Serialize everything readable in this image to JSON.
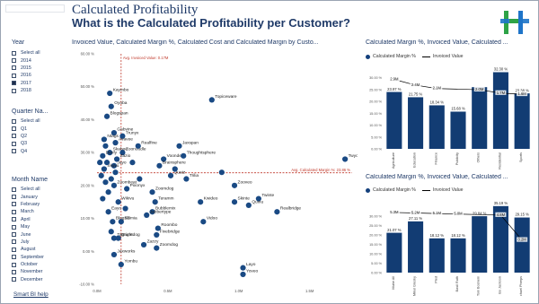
{
  "header": {
    "title": "Calculated Profitability",
    "subtitle": "What is the Calculated Profitability per Customer?"
  },
  "colors": {
    "bar": "#123c73",
    "dot": "#1a4a84",
    "ref_line": "#c0392b",
    "accent_green": "#2ea347",
    "accent_blue": "#1e74c8"
  },
  "slicers": {
    "year": {
      "title": "Year",
      "items": [
        {
          "label": "Select all",
          "checked": false
        },
        {
          "label": "2014",
          "checked": false
        },
        {
          "label": "2015",
          "checked": false
        },
        {
          "label": "2016",
          "checked": false
        },
        {
          "label": "2017",
          "checked": true
        },
        {
          "label": "2018",
          "checked": false
        }
      ]
    },
    "quarter": {
      "title": "Quarter Na...",
      "items": [
        {
          "label": "Select all",
          "checked": false
        },
        {
          "label": "Q1",
          "checked": false
        },
        {
          "label": "Q2",
          "checked": false
        },
        {
          "label": "Q3",
          "checked": false
        },
        {
          "label": "Q4",
          "checked": false
        }
      ]
    },
    "month": {
      "title": "Month Name",
      "items": [
        {
          "label": "Select all",
          "checked": false
        },
        {
          "label": "January",
          "checked": false
        },
        {
          "label": "February",
          "checked": false
        },
        {
          "label": "March",
          "checked": false
        },
        {
          "label": "April",
          "checked": false
        },
        {
          "label": "May",
          "checked": false
        },
        {
          "label": "June",
          "checked": false
        },
        {
          "label": "July",
          "checked": false
        },
        {
          "label": "August",
          "checked": false
        },
        {
          "label": "September",
          "checked": false
        },
        {
          "label": "October",
          "checked": false
        },
        {
          "label": "November",
          "checked": false
        },
        {
          "label": "December",
          "checked": false
        }
      ]
    },
    "help_label": "Smart BI help"
  },
  "chart_data": [
    {
      "type": "scatter",
      "title": "Invoiced Value, Calculated Margin %, Calculated Cost and Calculated Margin by Custo...",
      "x_ticks": [
        "0.0M",
        "0.5M",
        "1.0M",
        "1.5M"
      ],
      "y_ticks": [
        "60.00 %",
        "50.00 %",
        "40.00 %",
        "30.00 %",
        "20.00 %",
        "10.00 %",
        "0.00 %",
        "-10.00 %"
      ],
      "xlim": [
        0,
        1.8
      ],
      "ylim": [
        -10,
        60
      ],
      "ref_x": {
        "value": 0.17,
        "label": "Avg. Invoiced Value: 0.17M"
      },
      "ref_y": {
        "value": 23.86,
        "label": "Avg. Calculated Margin %: 23.86 %"
      },
      "points": [
        {
          "label": "Kaymbo",
          "x": 0.09,
          "y": 48
        },
        {
          "label": "Blogspan",
          "x": 0.07,
          "y": 41
        },
        {
          "label": "Oyoba",
          "x": 0.1,
          "y": 44
        },
        {
          "label": "Topiceware",
          "x": 0.81,
          "y": 46
        },
        {
          "label": "Twyo",
          "x": 1.75,
          "y": 28
        },
        {
          "label": "Gabvine",
          "x": 0.12,
          "y": 36
        },
        {
          "label": "Ntags",
          "x": 0.05,
          "y": 34
        },
        {
          "label": "Trunyx",
          "x": 0.18,
          "y": 35
        },
        {
          "label": "Avavee",
          "x": 0.13,
          "y": 33
        },
        {
          "label": "Skaboo",
          "x": 0.09,
          "y": 30
        },
        {
          "label": "Zoonoodle",
          "x": 0.18,
          "y": 30
        },
        {
          "label": "Realfine",
          "x": 0.29,
          "y": 32
        },
        {
          "label": "Jaxspan",
          "x": 0.58,
          "y": 32
        },
        {
          "label": "Devfy",
          "x": 0.04,
          "y": 29
        },
        {
          "label": "Zazio",
          "x": 0.14,
          "y": 28
        },
        {
          "label": "Voonder",
          "x": 0.47,
          "y": 28
        },
        {
          "label": "Thoughtsphere",
          "x": 0.61,
          "y": 29
        },
        {
          "label": "Jayo",
          "x": 0.12,
          "y": 26
        },
        {
          "label": "Skyvu",
          "x": 0.05,
          "y": 25
        },
        {
          "label": "Brainsphere",
          "x": 0.44,
          "y": 26
        },
        {
          "label": "Quatz",
          "x": 0.52,
          "y": 23
        },
        {
          "label": "Trilia",
          "x": 0.63,
          "y": 22
        },
        {
          "label": "Zoombeat",
          "x": 0.12,
          "y": 20
        },
        {
          "label": "Pixonyx",
          "x": 0.21,
          "y": 19
        },
        {
          "label": "Zoomdog",
          "x": 0.39,
          "y": 18
        },
        {
          "label": "Zooveo",
          "x": 0.97,
          "y": 20
        },
        {
          "label": "Twinte",
          "x": 1.14,
          "y": 16
        },
        {
          "label": "Quinu",
          "x": 1.07,
          "y": 14
        },
        {
          "label": "Realbridge",
          "x": 1.27,
          "y": 12
        },
        {
          "label": "Skinte",
          "x": 0.97,
          "y": 15
        },
        {
          "label": "Kwideo",
          "x": 0.73,
          "y": 15
        },
        {
          "label": "Teramm",
          "x": 0.41,
          "y": 15
        },
        {
          "label": "Wikivu",
          "x": 0.15,
          "y": 15
        },
        {
          "label": "Bubblemix",
          "x": 0.39,
          "y": 12
        },
        {
          "label": "Jabbertype",
          "x": 0.35,
          "y": 11
        },
        {
          "label": "Skimia",
          "x": 0.17,
          "y": 9
        },
        {
          "label": "Eayo",
          "x": 0.08,
          "y": 12
        },
        {
          "label": "BlogXS",
          "x": 0.11,
          "y": 9
        },
        {
          "label": "Roombo",
          "x": 0.43,
          "y": 7
        },
        {
          "label": "Vidoo",
          "x": 0.75,
          "y": 9
        },
        {
          "label": "Fivebridge",
          "x": 0.42,
          "y": 5
        },
        {
          "label": "Tagtune",
          "x": 0.12,
          "y": 4
        },
        {
          "label": "Brightdog",
          "x": 0.15,
          "y": 4
        },
        {
          "label": "Zazzy",
          "x": 0.33,
          "y": 2
        },
        {
          "label": "Zoomdog",
          "x": 0.42,
          "y": 1
        },
        {
          "label": "Jaxworks",
          "x": 0.12,
          "y": -1
        },
        {
          "label": "Yombu",
          "x": 0.17,
          "y": -4
        },
        {
          "label": "Layo",
          "x": 1.03,
          "y": -5
        },
        {
          "label": "Yoveo",
          "x": 1.03,
          "y": -7
        },
        {
          "label": "",
          "x": 0.02,
          "y": 27
        },
        {
          "label": "",
          "x": 0.03,
          "y": 23
        },
        {
          "label": "",
          "x": 0.06,
          "y": 21
        },
        {
          "label": "",
          "x": 0.08,
          "y": 18
        },
        {
          "label": "",
          "x": 0.04,
          "y": 16
        },
        {
          "label": "",
          "x": 0.1,
          "y": 22
        },
        {
          "label": "",
          "x": 0.13,
          "y": 24
        },
        {
          "label": "",
          "x": 0.07,
          "y": 27
        },
        {
          "label": "",
          "x": 0.06,
          "y": 32
        },
        {
          "label": "",
          "x": 0.25,
          "y": 27
        },
        {
          "label": "",
          "x": 0.3,
          "y": 22
        },
        {
          "label": "",
          "x": 0.2,
          "y": 13
        },
        {
          "label": "",
          "x": 0.1,
          "y": 6
        },
        {
          "label": "",
          "x": 0.55,
          "y": 25
        },
        {
          "label": "",
          "x": 0.88,
          "y": 24
        }
      ]
    },
    {
      "type": "bar",
      "title": "Calculated Margin %, Invoiced Value, Calculated ...",
      "legend": [
        "Calculated Margin %",
        "Invoiced Value"
      ],
      "y_ticks": [
        "30.00 %",
        "25.00 %",
        "20.00 %",
        "15.00 %",
        "10.00 %",
        "5.00 %",
        "0.00 %"
      ],
      "ylim": [
        0,
        34
      ],
      "categories": [
        "Agriculture",
        "Education",
        "Finance",
        "Publicity",
        "Others",
        "Residential",
        "Sports"
      ],
      "values": [
        23.97,
        21.75,
        18.34,
        15.68,
        26.0,
        32.3,
        23.38
      ],
      "value_labels": [
        "23.97 %",
        "21.75 %",
        "18.34 %",
        "15.68 %",
        "",
        "32.30 %",
        "23.38 %"
      ],
      "invoiced_labels": [
        "2.9M",
        "2.4M",
        "2.1M",
        "",
        "2.0M",
        "1.7M",
        "1.6M"
      ],
      "invoiced": [
        2.9,
        2.4,
        2.1,
        2.05,
        2.0,
        1.7,
        1.6
      ]
    },
    {
      "type": "bar",
      "title": "Calculated Margin %, Invoiced Value, Calculated ...",
      "legend": [
        "Calculated Margin %",
        "Invoiced Value"
      ],
      "y_ticks": [
        "30.00 %",
        "25.00 %",
        "20.00 %",
        "15.00 %",
        "10.00 %",
        "5.00 %",
        "0.00 %"
      ],
      "ylim": [
        0,
        37
      ],
      "categories": [
        "Muhe All",
        "Mikel Gresky",
        "Pied",
        "Basil Ruth",
        "Tom Bosnem",
        "Bo Jackson",
        "Michael Phreps"
      ],
      "values": [
        21.07,
        27.11,
        18.12,
        18.12,
        29.84,
        35.19,
        29.15
      ],
      "value_labels": [
        "21.07 %",
        "27.11 %",
        "18.12 %",
        "18.12 %",
        "29.84 %",
        "35.19 %",
        "29.15 %"
      ],
      "invoiced_labels": [
        "5.3M",
        "5.2M",
        "5.1M",
        "5.0M",
        "",
        "4.8M",
        "0.2M"
      ],
      "invoiced": [
        5.3,
        5.2,
        5.1,
        5.0,
        4.9,
        4.8,
        0.2
      ]
    }
  ]
}
